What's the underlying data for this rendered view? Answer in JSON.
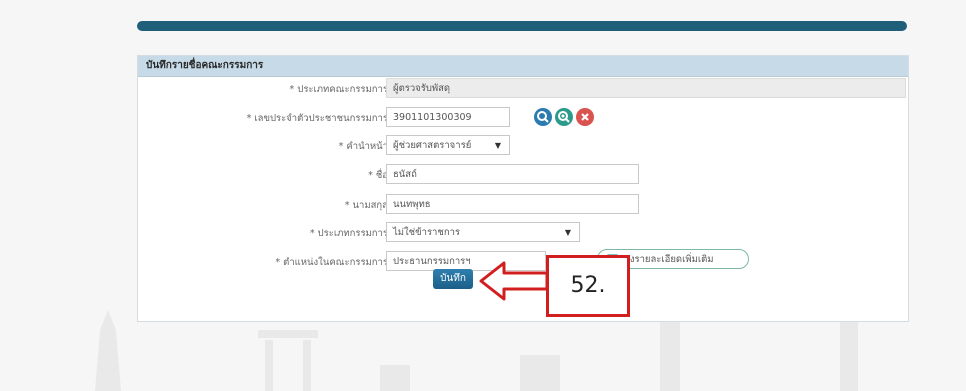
{
  "panel": {
    "title": "บันทึกรายชื่อคณะกรรมการ"
  },
  "form": {
    "committee_type": {
      "label": "* ประเภทคณะกรรมการ",
      "value": "ผู้ตรวจรับพัสดุ"
    },
    "citizen_id": {
      "label": "* เลขประจำตัวประชาชนกรรมการ",
      "value": "3901101300309"
    },
    "prefix": {
      "label": "* คำนำหน้า",
      "value": "ผู้ช่วยศาสตราจารย์"
    },
    "first_name": {
      "label": "* ชื่อ",
      "value": "ธนัสถ์"
    },
    "last_name": {
      "label": "* นามสกุล",
      "value": "นนทพุทธ"
    },
    "member_type": {
      "label": "* ประเภทกรรมการ",
      "value": "ไม่ใช่ข้าราชการ"
    },
    "position": {
      "label": "* ตำแหน่งในคณะกรรมการ",
      "value": "ประธานกรรมการฯ"
    }
  },
  "buttons": {
    "detail": "ลงรายละเอียดเพิ่มเติม",
    "save": "บันทึก"
  },
  "annotation": {
    "step": "52."
  },
  "icons": [
    "search-icon",
    "zoom-search-icon",
    "clear-icon",
    "chevron-down-icon",
    "edit-icon"
  ],
  "colors": {
    "header_bar": "#1f5f79",
    "panel_header": "#c6dae8",
    "annotation": "#d11f1f"
  }
}
